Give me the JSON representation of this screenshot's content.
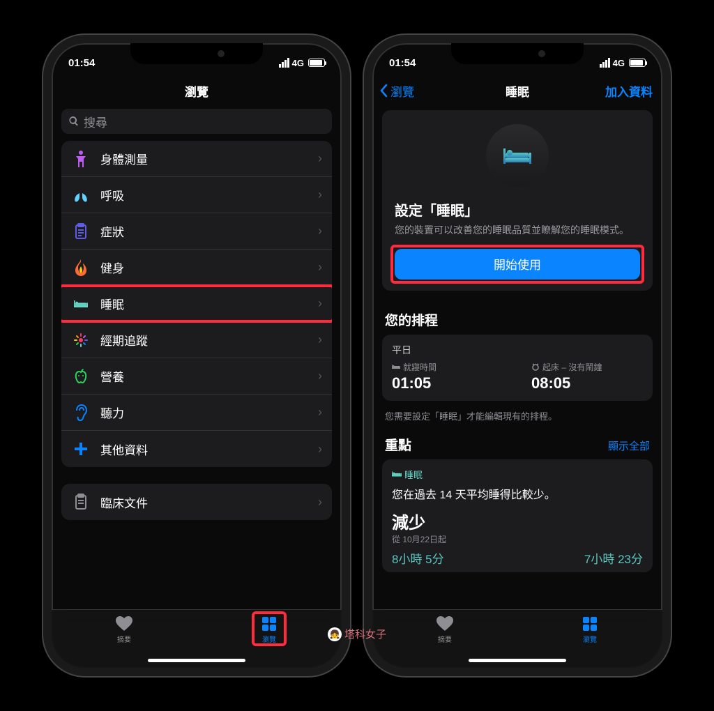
{
  "status": {
    "time": "01:54",
    "network": "4G"
  },
  "left": {
    "title": "瀏覽",
    "search_placeholder": "搜尋",
    "categories": [
      {
        "name": "body",
        "label": "身體測量",
        "color": "#bf5af2"
      },
      {
        "name": "respiratory",
        "label": "呼吸",
        "color": "#64d2ff"
      },
      {
        "name": "symptoms",
        "label": "症狀",
        "color": "#5e5ce6"
      },
      {
        "name": "fitness",
        "label": "健身",
        "color": "#ff6b35"
      },
      {
        "name": "sleep",
        "label": "睡眠",
        "color": "#63d6c8",
        "highlight": true
      },
      {
        "name": "cycle",
        "label": "經期追蹤",
        "color": "#ff375f"
      },
      {
        "name": "nutrition",
        "label": "營養",
        "color": "#30d158"
      },
      {
        "name": "hearing",
        "label": "聽力",
        "color": "#0a84ff"
      },
      {
        "name": "other",
        "label": "其他資料",
        "color": "#0a84ff"
      }
    ],
    "secondary": [
      {
        "name": "clinical",
        "label": "臨床文件",
        "color": "#8e8e93"
      }
    ]
  },
  "right": {
    "back_label": "瀏覽",
    "title": "睡眠",
    "add_label": "加入資料",
    "hero": {
      "title": "設定「睡眠」",
      "subtitle": "您的裝置可以改善您的睡眠品質並瞭解您的睡眠模式。",
      "cta": "開始使用"
    },
    "schedule": {
      "title": "您的排程",
      "day": "平日",
      "bed_label": "就寢時間",
      "bed_time": "01:05",
      "wake_label": "起床 – 沒有鬧鐘",
      "wake_time": "08:05",
      "hint": "您需要設定「睡眠」才能編輯現有的排程。"
    },
    "highlights": {
      "title": "重點",
      "show_all": "顯示全部",
      "tag": "睡眠",
      "text": "您在過去 14 天平均睡得比較少。",
      "big": "減少",
      "sub": "從 10月22日起",
      "t1": "8小時 5分",
      "t2": "7小時 23分"
    }
  },
  "tabs": {
    "summary": "摘要",
    "browse": "瀏覽"
  },
  "watermark": "塔科女子"
}
